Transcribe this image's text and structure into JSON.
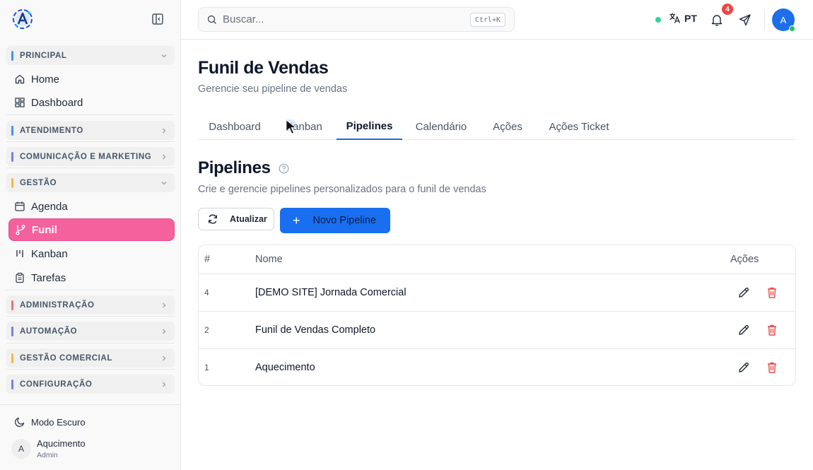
{
  "sidebar": {
    "groups": [
      {
        "label": "PRINCIPAL",
        "color": "#4f8ef7"
      },
      {
        "label": "ATENDIMENTO",
        "color": "#4f8ef7"
      },
      {
        "label": "COMUNICAÇÃO E MARKETING",
        "color": "#7c7cf0"
      },
      {
        "label": "GESTÃO",
        "color": "#f5b942"
      },
      {
        "label": "ADMINISTRAÇÃO",
        "color": "#f06e7a"
      },
      {
        "label": "AUTOMAÇÃO",
        "color": "#7c7cf0"
      },
      {
        "label": "GESTÃO COMERCIAL",
        "color": "#f5b942"
      },
      {
        "label": "CONFIGURAÇÃO",
        "color": "#7c7cf0"
      }
    ],
    "items": [
      {
        "label": "Home",
        "icon": "home-icon"
      },
      {
        "label": "Dashboard",
        "icon": "dashboard-icon"
      },
      {
        "label": "Agenda",
        "icon": "calendar-icon"
      },
      {
        "label": "Funil",
        "icon": "git-branch-icon"
      },
      {
        "label": "Kanban",
        "icon": "kanban-icon"
      },
      {
        "label": "Tarefas",
        "icon": "clipboard-icon"
      }
    ],
    "dark_mode_label": "Modo Escuro",
    "user": {
      "initial": "A",
      "name": "Aqucimento",
      "role": "Admin"
    }
  },
  "header": {
    "search_placeholder": "Buscar...",
    "shortcut": "Ctrl+K",
    "language": "PT",
    "notification_count": "4",
    "avatar_initial": "A"
  },
  "page": {
    "title": "Funil de Vendas",
    "subtitle": "Gerencie seu pipeline de vendas",
    "tabs": [
      "Dashboard",
      "Kanban",
      "Pipelines",
      "Calendário",
      "Ações",
      "Ações Ticket"
    ],
    "active_tab": "Pipelines"
  },
  "section": {
    "title": "Pipelines",
    "description": "Crie e gerencie pipelines personalizados para o funil de vendas",
    "refresh_label": "Atualizar",
    "new_label": "Novo Pipeline"
  },
  "table": {
    "headers": {
      "id": "#",
      "name": "Nome",
      "actions": "Ações"
    },
    "rows": [
      {
        "id": "4",
        "name": "[DEMO SITE] Jornada Comercial"
      },
      {
        "id": "2",
        "name": "Funil de Vendas Completo"
      },
      {
        "id": "1",
        "name": "Aquecimento"
      }
    ]
  },
  "colors": {
    "accent": "#1a6ff0",
    "active_item": "#f4619c",
    "delete": "#ef4444"
  }
}
